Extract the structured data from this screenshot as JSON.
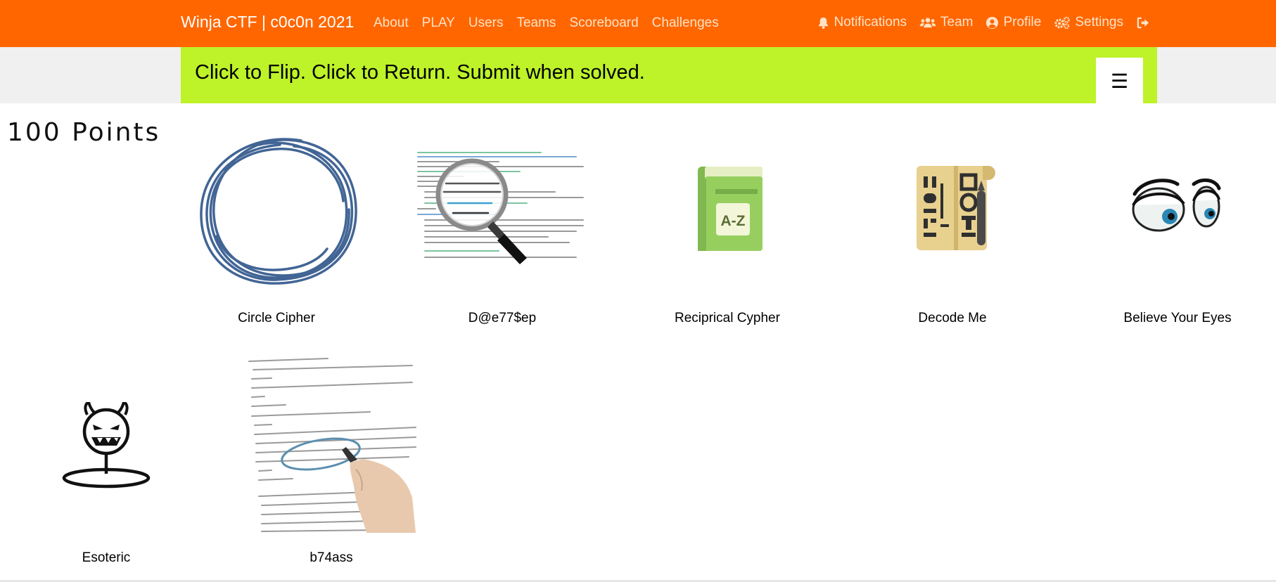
{
  "navbar": {
    "brand": "Winja CTF | c0c0n 2021",
    "left_links": [
      "About",
      "PLAY",
      "Users",
      "Teams",
      "Scoreboard",
      "Challenges"
    ],
    "right_items": [
      {
        "label": "Notifications",
        "icon": "bell-icon"
      },
      {
        "label": "Team",
        "icon": "users-icon"
      },
      {
        "label": "Profile",
        "icon": "user-circle-icon"
      },
      {
        "label": "Settings",
        "icon": "cogs-icon"
      },
      {
        "label": "",
        "icon": "sign-out-icon"
      }
    ],
    "color": "#ff6600"
  },
  "banner": {
    "text": "Click to Flip. Click to Return. Submit when solved.",
    "menu_glyph": "☰",
    "color": "#bef229"
  },
  "section": {
    "heading": "100 Points"
  },
  "challenges": [
    {
      "title": "Circle Cipher",
      "icon": "scribble-circle-icon"
    },
    {
      "title": "D@e77$ep",
      "icon": "magnifier-code-icon"
    },
    {
      "title": "Reciprical Cypher",
      "icon": "dictionary-book-icon"
    },
    {
      "title": "Decode Me",
      "icon": "scroll-glyphs-icon"
    },
    {
      "title": "Believe Your Eyes",
      "icon": "cartoon-eyes-icon"
    },
    {
      "title": "Esoteric",
      "icon": "devil-face-icon"
    },
    {
      "title": "b74ass",
      "icon": "hand-marking-code-icon"
    }
  ]
}
